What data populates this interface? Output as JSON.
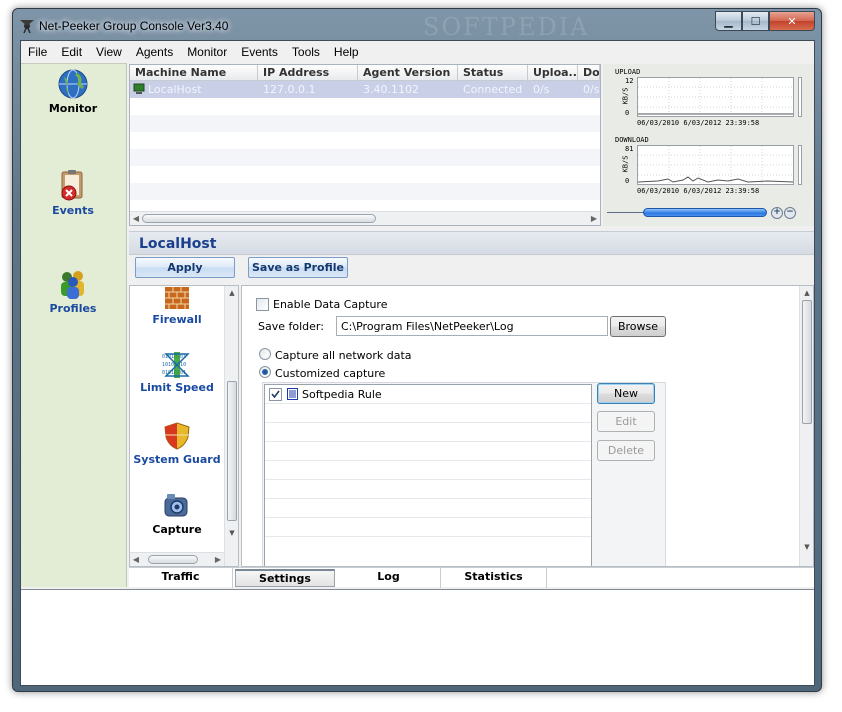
{
  "window": {
    "title": "Net-Peeker Group Console Ver3.40",
    "watermark": "SOFTPEDIA",
    "controls": {
      "minimize": "▁",
      "maximize": "☐",
      "close": "✕"
    }
  },
  "menu": [
    "File",
    "Edit",
    "View",
    "Agents",
    "Monitor",
    "Events",
    "Tools",
    "Help"
  ],
  "nav": {
    "monitor": "Monitor",
    "events": "Events",
    "profiles": "Profiles"
  },
  "machines": {
    "columns": [
      "Machine Name",
      "IP Address",
      "Agent Version",
      "Status",
      "Uploa...",
      "Dow"
    ],
    "rows": [
      [
        "LocalHost",
        "127.0.0.1",
        "3.40.1102",
        "Connected",
        "0/s",
        "0/s"
      ]
    ]
  },
  "graphs": {
    "upload": {
      "title": "UPLOAD",
      "max": "12",
      "unit": "KB/S",
      "zero": "0",
      "dates": "06/03/2010 6/03/2012  23:39:58"
    },
    "download": {
      "title": "DOWNLOAD",
      "max": "81",
      "unit": "KB/S",
      "zero": "0",
      "dates": "06/03/2010 6/03/2012  23:39:58"
    },
    "zoom_in": "+",
    "zoom_out": "−"
  },
  "host": {
    "title": "LocalHost"
  },
  "actions": {
    "apply": "Apply",
    "save_profile": "Save as Profile"
  },
  "tools": [
    "Firewall",
    "Limit Speed",
    "System Guard",
    "Capture"
  ],
  "capture": {
    "enable_label": "Enable Data Capture",
    "save_folder_label": "Save folder:",
    "save_folder_value": "C:\\Program Files\\NetPeeker\\Log",
    "browse": "Browse",
    "all_label": "Capture all network data",
    "custom_label": "Customized capture",
    "rules": [
      "Softpedia Rule"
    ],
    "new": "New",
    "edit": "Edit",
    "delete": "Delete"
  },
  "tabs": [
    "Traffic",
    "Settings",
    "Log",
    "Statistics"
  ],
  "colors": {
    "nav_bg": "#e3ecd4",
    "host_title": "#1a3f8c",
    "tool_label": "#1a4aa0"
  }
}
